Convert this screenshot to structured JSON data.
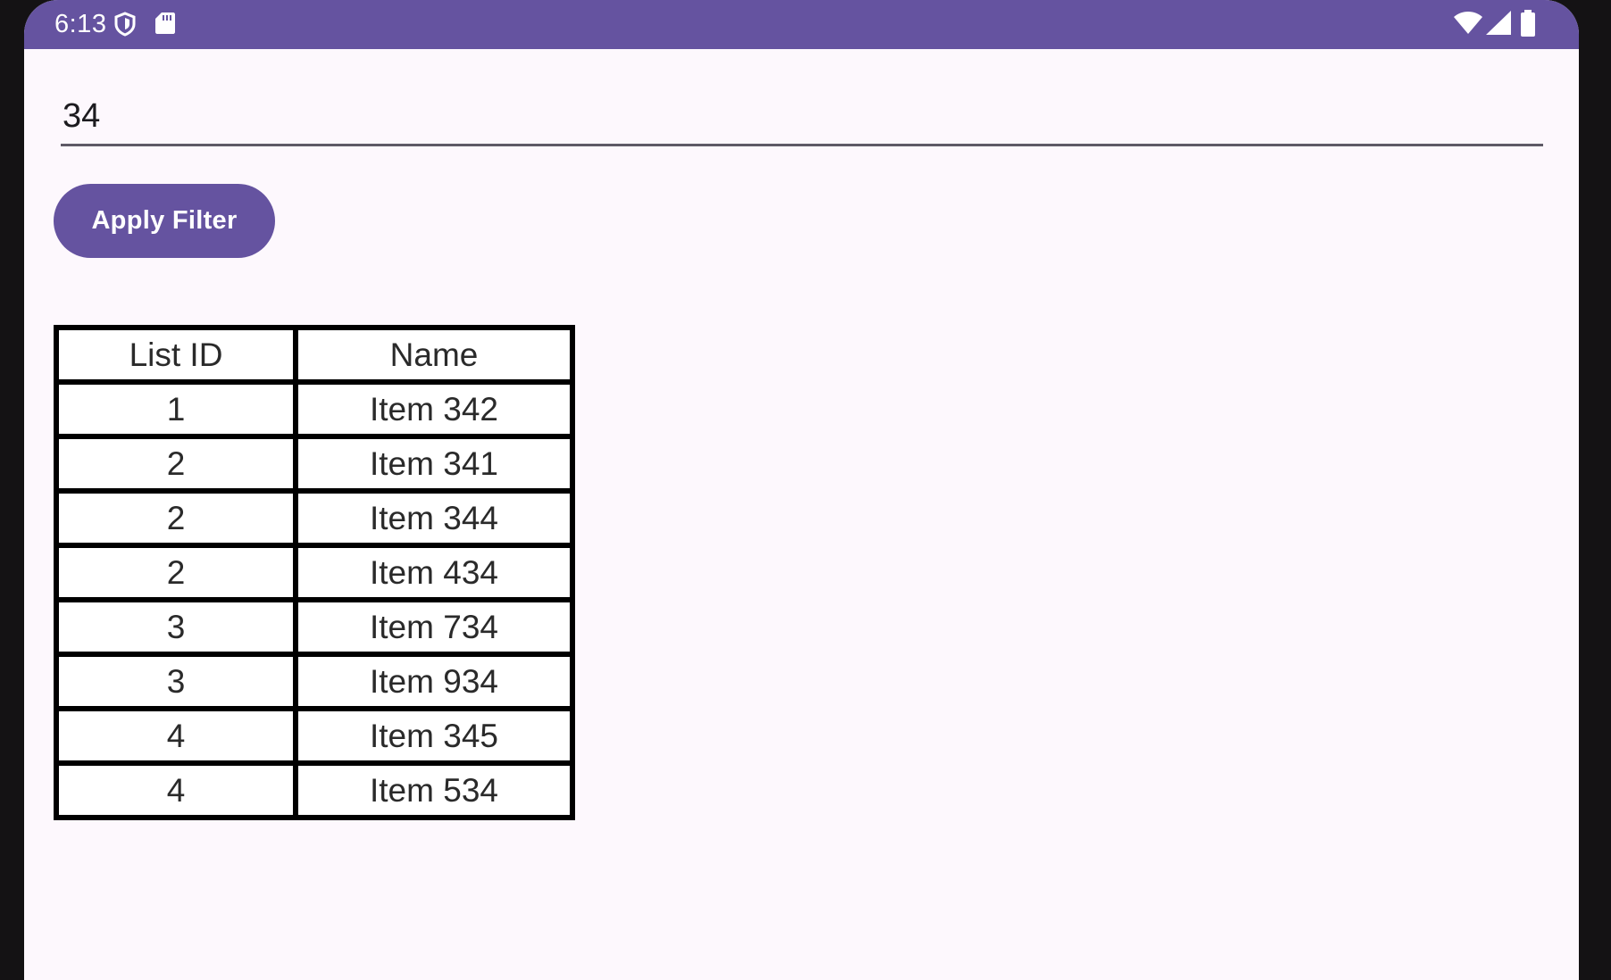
{
  "status_bar": {
    "time": "6:13",
    "icons_left": [
      "shield-icon",
      "sd-card-icon"
    ],
    "icons_right": [
      "wifi-icon",
      "signal-icon",
      "battery-icon"
    ],
    "color": "#6553a0"
  },
  "filter": {
    "value": "34"
  },
  "apply_button": {
    "label": "Apply Filter",
    "color": "#6553a0"
  },
  "table": {
    "headers": [
      "List ID",
      "Name"
    ],
    "rows": [
      [
        "1",
        "Item 342"
      ],
      [
        "2",
        "Item 341"
      ],
      [
        "2",
        "Item 344"
      ],
      [
        "2",
        "Item 434"
      ],
      [
        "3",
        "Item 734"
      ],
      [
        "3",
        "Item 934"
      ],
      [
        "4",
        "Item 345"
      ],
      [
        "4",
        "Item 534"
      ]
    ]
  }
}
